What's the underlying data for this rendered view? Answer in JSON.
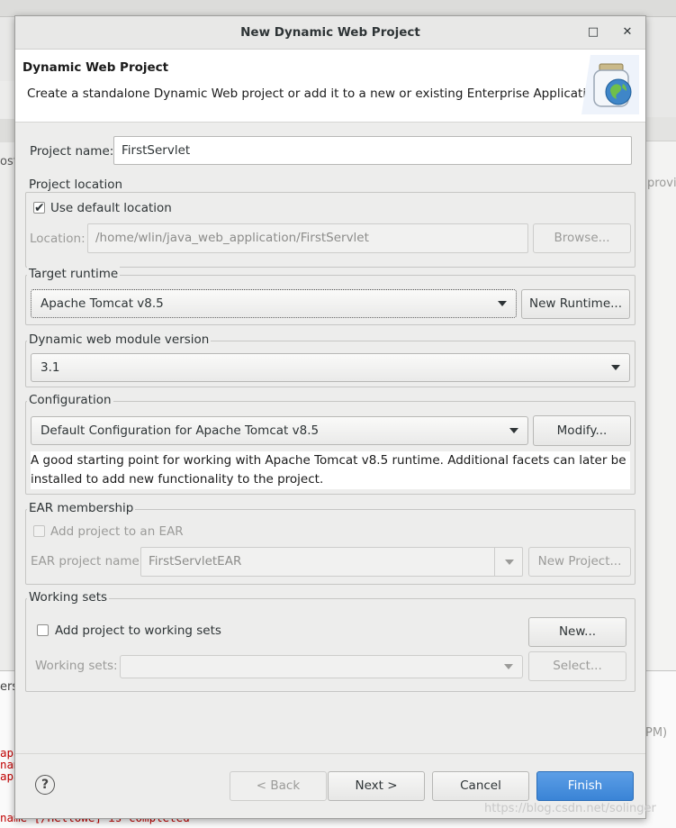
{
  "dialog": {
    "title": "New Dynamic Web Project",
    "maximize_icon": "□",
    "close_icon": "✕"
  },
  "header": {
    "title": "Dynamic Web Project",
    "description": "Create a standalone Dynamic Web project or add it to a new or existing Enterprise Application.",
    "icon": "jar-globe-icon"
  },
  "project_name": {
    "label": "Project name:",
    "value": "FirstServlet"
  },
  "project_location": {
    "group_label": "Project location",
    "use_default_label": "Use default location",
    "use_default_checked": true,
    "location_label": "Location:",
    "location_value": "/home/wlin/java_web_application/FirstServlet",
    "browse_label": "Browse..."
  },
  "target_runtime": {
    "group_label": "Target runtime",
    "selected": "Apache Tomcat v8.5",
    "new_runtime_label": "New Runtime..."
  },
  "module_version": {
    "group_label": "Dynamic web module version",
    "selected": "3.1"
  },
  "configuration": {
    "group_label": "Configuration",
    "selected": "Default Configuration for Apache Tomcat v8.5",
    "modify_label": "Modify...",
    "description_line1": "A good starting point for working with Apache Tomcat v8.5 runtime. Additional facets can later be",
    "description_line2": "installed to add new functionality to the project."
  },
  "ear": {
    "group_label": "EAR membership",
    "add_label": "Add project to an EAR",
    "add_checked": false,
    "name_label": "EAR project name:",
    "name_value": "FirstServletEAR",
    "new_project_label": "New Project..."
  },
  "working_sets": {
    "group_label": "Working sets",
    "add_label": "Add project to working sets",
    "add_checked": false,
    "new_label": "New...",
    "sets_label": "Working sets:",
    "sets_value": "",
    "select_label": "Select..."
  },
  "footer": {
    "help_icon": "?",
    "back_label": "< Back",
    "next_label": "Next >",
    "cancel_label": "Cancel",
    "finish_label": "Finish"
  },
  "background": {
    "left_fragment": "ost",
    "right_fragment": "provi",
    "right_pm": "PM)",
    "left_tab": "ers",
    "console_lines": [
      "apa",
      "nam",
      "apa",
      "name [/HelloWe] is completed"
    ],
    "watermark": "https://blog.csdn.net/solinger"
  },
  "colors": {
    "finish_button": "#3a84d6",
    "dialog_bg": "#ededec",
    "header_bg": "#ffffff",
    "console_text": "#c00000"
  }
}
